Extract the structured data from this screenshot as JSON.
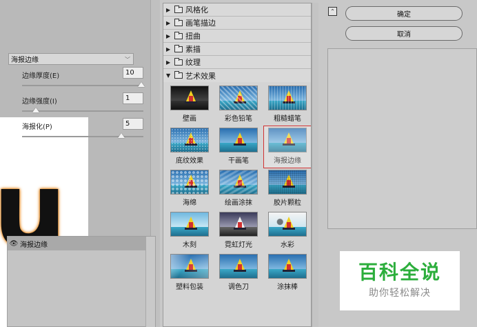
{
  "preview": {
    "letter": "u"
  },
  "gallery": {
    "folders_top": [
      {
        "label": "风格化",
        "arrow": "▶"
      },
      {
        "label": "画笔描边",
        "arrow": "▶"
      },
      {
        "label": "扭曲",
        "arrow": "▶"
      },
      {
        "label": "素描",
        "arrow": "▶"
      },
      {
        "label": "纹理",
        "arrow": "▶"
      }
    ],
    "open_folder": {
      "label": "艺术效果",
      "arrow": "▼"
    },
    "thumbs": [
      {
        "label": "壁画",
        "style": "t-dark"
      },
      {
        "label": "彩色铅笔",
        "style": "t-colorpencil"
      },
      {
        "label": "粗糙蜡笔",
        "style": "t-rough"
      },
      {
        "label": "底纹效果",
        "style": "t-under"
      },
      {
        "label": "干画笔",
        "style": ""
      },
      {
        "label": "海报边缘",
        "style": "",
        "selected": true
      },
      {
        "label": "海绵",
        "style": "t-sponge"
      },
      {
        "label": "绘画涂抹",
        "style": "t-paint"
      },
      {
        "label": "胶片颗粒",
        "style": "t-film"
      },
      {
        "label": "木刻",
        "style": "t-wood"
      },
      {
        "label": "霓虹灯光",
        "style": "t-neon"
      },
      {
        "label": "水彩",
        "style": "t-water"
      },
      {
        "label": "塑料包装",
        "style": "t-plastic"
      },
      {
        "label": "调色刀",
        "style": ""
      },
      {
        "label": "涂抹棒",
        "style": ""
      }
    ]
  },
  "buttons": {
    "ok": "确定",
    "cancel": "取消",
    "collapse": "⌃"
  },
  "settings": {
    "filter_select": "海报边缘",
    "params": [
      {
        "label": "边缘厚度(E)",
        "value": "10",
        "fraction": 1.0
      },
      {
        "label": "边缘强度(I)",
        "value": "1",
        "fraction": 0.1
      },
      {
        "label": "海报化(P)",
        "value": "5",
        "fraction": 0.83
      }
    ]
  },
  "layers": {
    "eye": "👁",
    "name": "海报边缘"
  },
  "watermark": {
    "title": "百科全说",
    "subtitle": "助你轻松解决"
  },
  "colors": {
    "accent_green": "#2cae3c",
    "selection_red": "#d03030"
  }
}
